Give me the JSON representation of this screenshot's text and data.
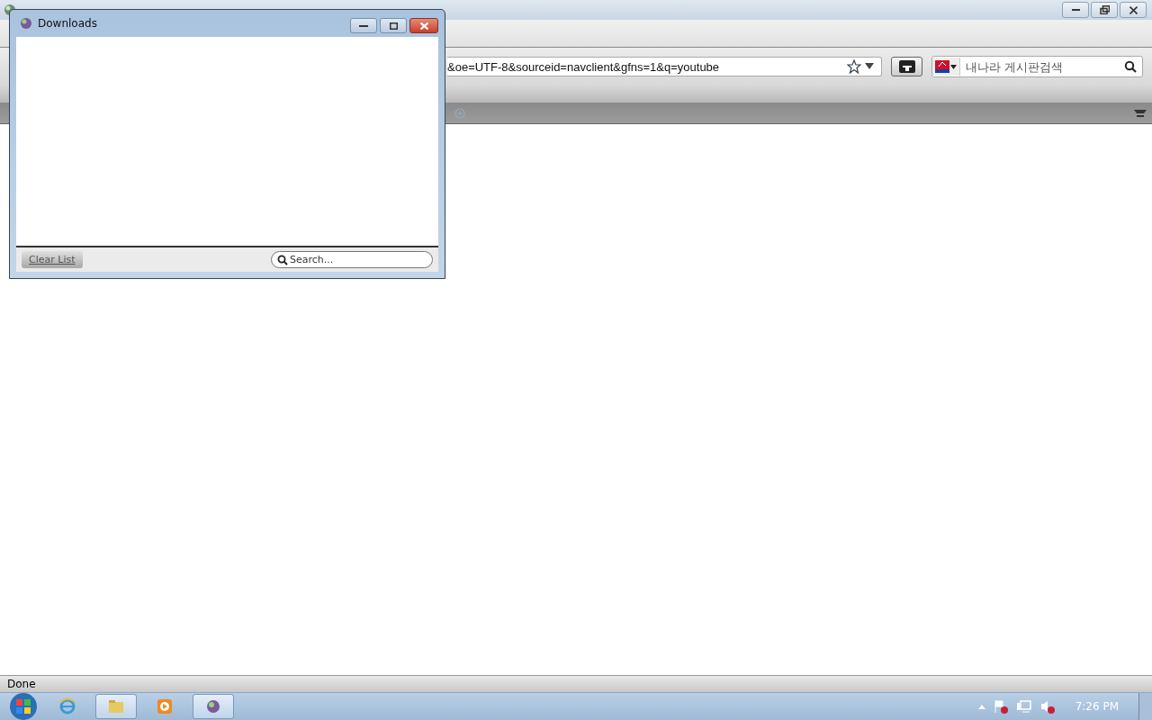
{
  "browser": {
    "url": "&oe=UTF-8&sourceid=navclient&gfns=1&q=youtube",
    "search_placeholder": "내나라 게시판검색",
    "status": "Done"
  },
  "downloads": {
    "title": "Downloads",
    "clear_button": "Clear List",
    "search_placeholder": "Search..."
  },
  "taskbar": {
    "items": [
      {
        "kind": "ie",
        "active": false
      },
      {
        "kind": "folder",
        "active": true
      },
      {
        "kind": "media",
        "active": false
      },
      {
        "kind": "firefox",
        "active": true
      }
    ],
    "time": "7:26 PM"
  }
}
